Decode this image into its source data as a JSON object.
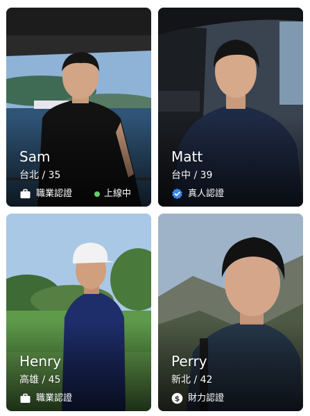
{
  "cards": [
    {
      "name": "Sam",
      "location": "台北 / 35",
      "badge_label": "職業認證",
      "badge_icon": "briefcase-icon",
      "online_label": "上線中"
    },
    {
      "name": "Matt",
      "location": "台中 / 39",
      "badge_label": "真人認證",
      "badge_icon": "verified-check-icon"
    },
    {
      "name": "Henry",
      "location": "高雄 / 45",
      "badge_label": "職業認證",
      "badge_icon": "briefcase-icon"
    },
    {
      "name": "Perry",
      "location": "新北 / 42",
      "badge_label": "財力認證",
      "badge_icon": "dollar-circle-icon"
    }
  ],
  "colors": {
    "online_dot": "#5fd068",
    "verified_badge": "#3d86e6",
    "text": "#ffffff"
  }
}
